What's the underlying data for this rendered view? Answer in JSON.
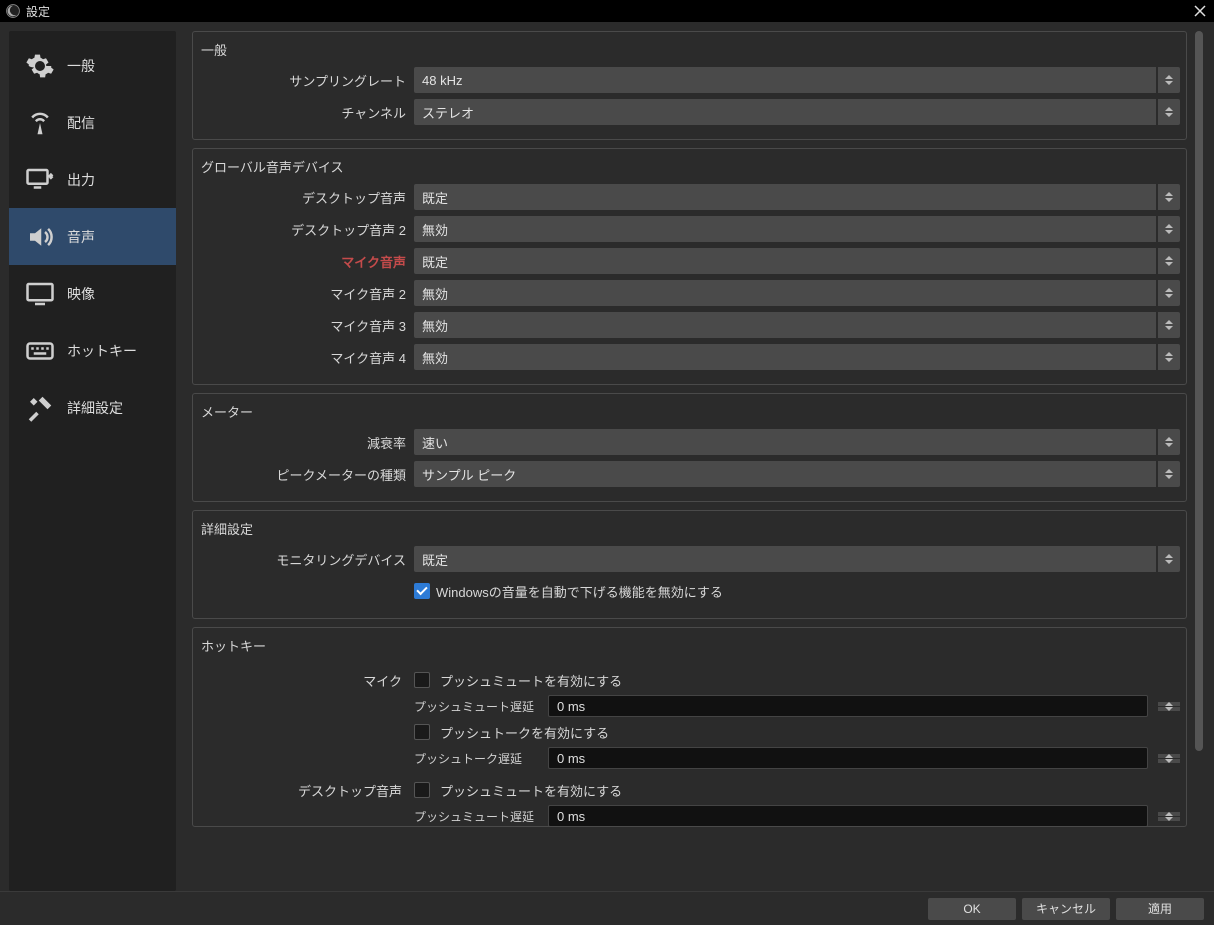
{
  "titlebar": {
    "title": "設定"
  },
  "sidebar": {
    "items": [
      {
        "label": "一般"
      },
      {
        "label": "配信"
      },
      {
        "label": "出力"
      },
      {
        "label": "音声"
      },
      {
        "label": "映像"
      },
      {
        "label": "ホットキー"
      },
      {
        "label": "詳細設定"
      }
    ]
  },
  "general_group": {
    "title": "一般",
    "sample_rate_label": "サンプリングレート",
    "sample_rate_value": "48 kHz",
    "channel_label": "チャンネル",
    "channel_value": "ステレオ"
  },
  "devices_group": {
    "title": "グローバル音声デバイス",
    "desktop1_label": "デスクトップ音声",
    "desktop1_value": "既定",
    "desktop2_label": "デスクトップ音声 2",
    "desktop2_value": "無効",
    "mic1_label": "マイク音声",
    "mic1_value": "既定",
    "mic2_label": "マイク音声 2",
    "mic2_value": "無効",
    "mic3_label": "マイク音声 3",
    "mic3_value": "無効",
    "mic4_label": "マイク音声 4",
    "mic4_value": "無効"
  },
  "meters_group": {
    "title": "メーター",
    "decay_label": "減衰率",
    "decay_value": "速い",
    "peak_label": "ピークメーターの種類",
    "peak_value": "サンプル ピーク"
  },
  "advanced_group": {
    "title": "詳細設定",
    "mon_label": "モニタリングデバイス",
    "mon_value": "既定",
    "win_ducking_label": "Windowsの音量を自動で下げる機能を無効にする"
  },
  "hotkeys_group": {
    "title": "ホットキー",
    "mic_block_label": "マイク",
    "desktop_block_label": "デスクトップ音声",
    "push_mute_enable": "プッシュミュートを有効にする",
    "push_mute_delay_label": "プッシュミュート遅延",
    "push_mute_delay_value": "0 ms",
    "push_talk_enable": "プッシュトークを有効にする",
    "push_talk_delay_label": "プッシュトーク遅延",
    "push_talk_delay_value": "0 ms",
    "desktop_push_mute_delay_value": "0 ms"
  },
  "footer": {
    "ok": "OK",
    "cancel": "キャンセル",
    "apply": "適用"
  }
}
